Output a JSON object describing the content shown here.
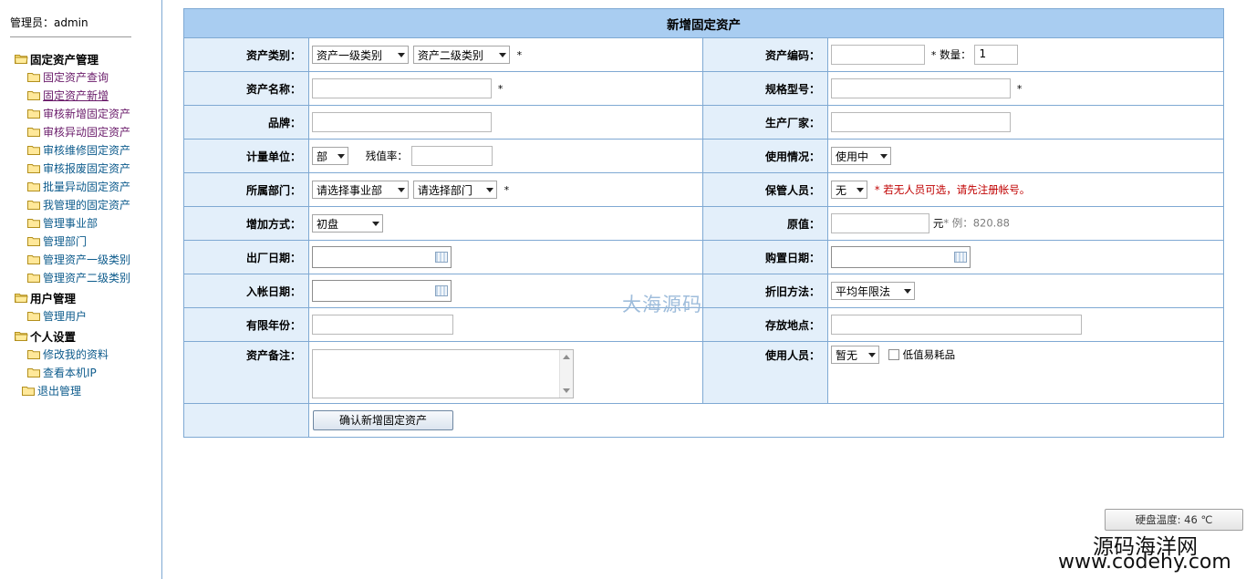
{
  "sidebar": {
    "admin_label": "管理员：admin",
    "groups": [
      {
        "label": "固定资产管理",
        "items": [
          "固定资产查询",
          "固定资产新增",
          "审核新增固定资产",
          "审核异动固定资产",
          "审核维修固定资产",
          "审核报废固定资产",
          "批量异动固定资产",
          "我管理的固定资产",
          "管理事业部",
          "管理部门",
          "管理资产一级类别",
          "管理资产二级类别"
        ]
      },
      {
        "label": "用户管理",
        "items": [
          "管理用户"
        ]
      },
      {
        "label": "个人设置",
        "items": [
          "修改我的资料",
          "查看本机IP"
        ]
      }
    ],
    "exit_label": "退出管理"
  },
  "form": {
    "title": "新增固定资产",
    "labels": {
      "category": "资产类别：",
      "code": "资产编码：",
      "quantity": "数量：",
      "name": "资产名称：",
      "model": "规格型号：",
      "brand": "品牌：",
      "manufacturer": "生产厂家：",
      "unit": "计量单位：",
      "residual": "残值率：",
      "usage": "使用情况：",
      "dept": "所属部门：",
      "keeper": "保管人员：",
      "add_method": "增加方式：",
      "original_value": "原值：",
      "factory_date": "出厂日期：",
      "purchase_date": "购置日期：",
      "entry_date": "入帐日期：",
      "depreciation": "折旧方法：",
      "years": "有限年份：",
      "location": "存放地点：",
      "remark": "资产备注：",
      "user": "使用人员："
    },
    "values": {
      "category1": "资产一级类别",
      "category2": "资产二级类别",
      "quantity": "1",
      "unit": "部",
      "usage": "使用中",
      "business_unit": "请选择事业部",
      "department": "请选择部门",
      "keeper": "无",
      "add_method": "初盘",
      "depreciation": "平均年限法",
      "user": "暂无"
    },
    "required_mark": "*",
    "keeper_hint": "* 若无人员可选，请先注册帐号。",
    "yuan_unit": "元",
    "value_example": "* 例：820.88",
    "low_value_label": "低值易耗品",
    "submit_label": "确认新增固定资产"
  },
  "watermark": "大海源码",
  "disk_temp": "硬盘温度: 46 ℃",
  "brand_cn": "源码海洋网",
  "brand_url": "www.codehy.com",
  "colors": {
    "header_bg": "#a9cdf1",
    "label_bg": "#e3effa",
    "border": "#7fa9d3",
    "link": "#0d5b8c",
    "hint_red": "#c00000"
  }
}
